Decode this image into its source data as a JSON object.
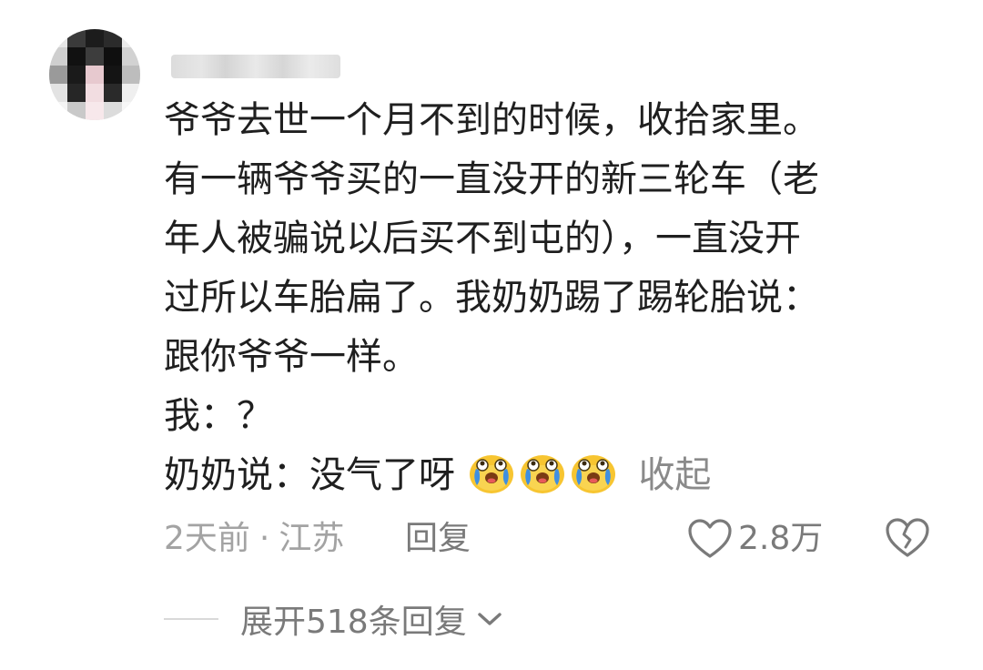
{
  "comment": {
    "lines": [
      "爷爷去世一个月不到的时候，收拾家里。",
      "有一辆爷爷买的一直没开的新三轮车（老",
      "年人被骗说以后买不到屯的），一直没开",
      "过所以车胎扁了。我奶奶踢了踢轮胎说：",
      "跟你爷爷一样。",
      "我：？"
    ],
    "last_line_text": "奶奶说：没气了呀",
    "emojis": [
      "crying-laugh-emoji",
      "crying-laugh-emoji",
      "crying-laugh-emoji"
    ],
    "collapse_label": "收起"
  },
  "meta": {
    "time": "2天前",
    "separator": "·",
    "location": "江苏",
    "reply_label": "回复",
    "like_count": "2.8万"
  },
  "replies": {
    "expand_label": "展开518条回复"
  },
  "icons": {
    "like": "heart-outline-icon",
    "dislike": "broken-heart-icon",
    "expand": "chevron-down-icon"
  },
  "colors": {
    "text": "#1f1f1f",
    "muted": "#a3a3a3",
    "secondary": "#7a7a7a",
    "emoji_face": "#f7c531",
    "emoji_tears": "#3f8fe0"
  }
}
